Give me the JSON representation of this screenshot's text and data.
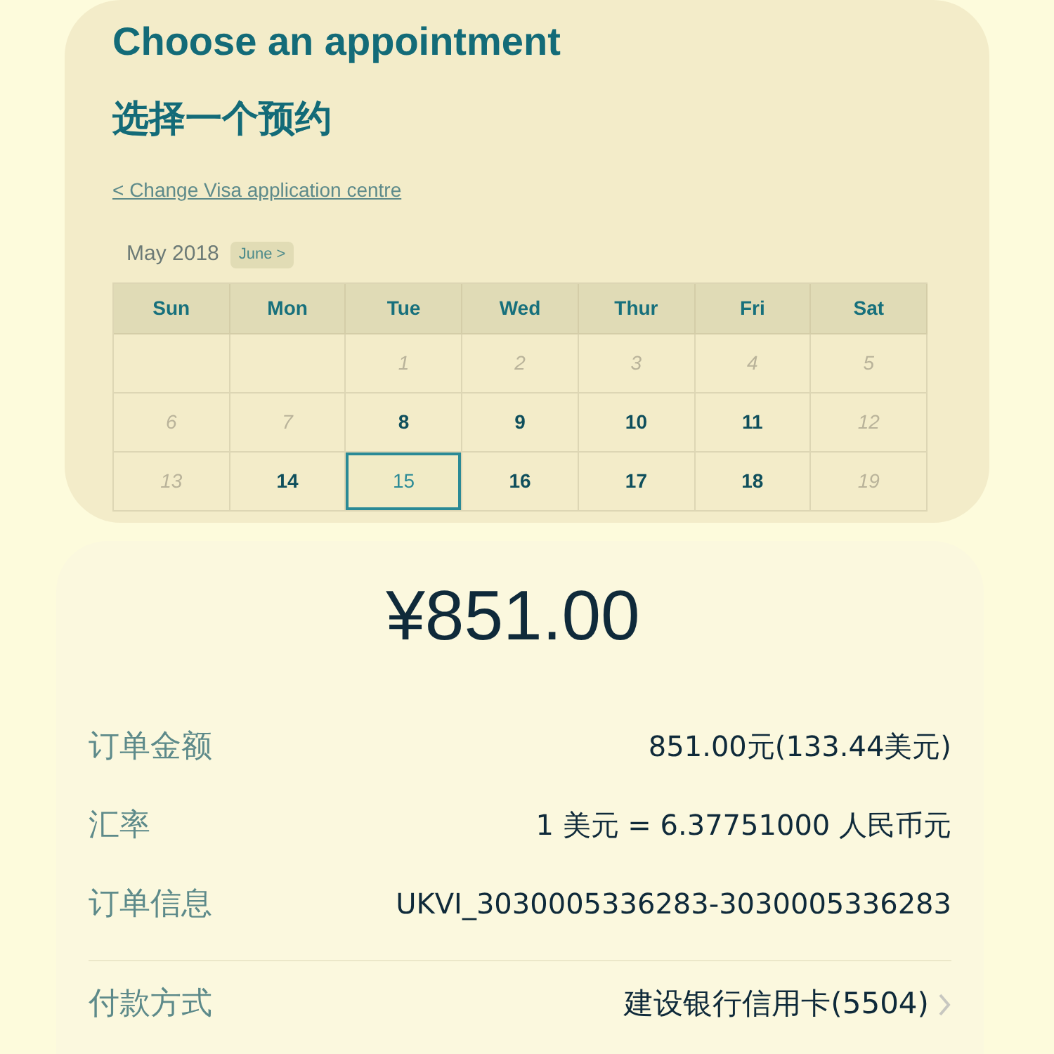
{
  "appointment": {
    "title": "Choose an appointment",
    "title_zh": "选择一个预约",
    "back_link": "< Change Visa application centre",
    "month": "May 2018",
    "next_month_button": "June >",
    "weekdays": [
      "Sun",
      "Mon",
      "Tue",
      "Wed",
      "Thur",
      "Fri",
      "Sat"
    ],
    "weeks": [
      [
        {
          "kind": "blank"
        },
        {
          "kind": "blank"
        },
        {
          "day": "1",
          "kind": "unavailable",
          "selected": false
        },
        {
          "day": "2",
          "kind": "unavailable",
          "selected": false
        },
        {
          "day": "3",
          "kind": "unavailable",
          "selected": false
        },
        {
          "day": "4",
          "kind": "unavailable",
          "selected": false
        },
        {
          "day": "5",
          "kind": "unavailable",
          "selected": false
        }
      ],
      [
        {
          "day": "6",
          "kind": "unavailable",
          "selected": false
        },
        {
          "day": "7",
          "kind": "unavailable",
          "selected": false
        },
        {
          "day": "8",
          "kind": "available",
          "selected": false
        },
        {
          "day": "9",
          "kind": "available",
          "selected": false
        },
        {
          "day": "10",
          "kind": "available",
          "selected": false
        },
        {
          "day": "11",
          "kind": "available",
          "selected": false
        },
        {
          "day": "12",
          "kind": "unavailable",
          "selected": false
        }
      ],
      [
        {
          "day": "13",
          "kind": "unavailable",
          "selected": false
        },
        {
          "day": "14",
          "kind": "available",
          "selected": false
        },
        {
          "day": "15",
          "kind": "available",
          "selected": true
        },
        {
          "day": "16",
          "kind": "available",
          "selected": false
        },
        {
          "day": "17",
          "kind": "available",
          "selected": false
        },
        {
          "day": "18",
          "kind": "available",
          "selected": false
        },
        {
          "day": "19",
          "kind": "unavailable",
          "selected": false
        }
      ]
    ]
  },
  "payment": {
    "amount": "¥851.00",
    "rows": [
      {
        "label": "订单金额",
        "value": "851.00元(133.44美元)",
        "kind": "info"
      },
      {
        "label": "汇率",
        "value": "1 美元 = 6.37751000 人民币元",
        "kind": "info"
      },
      {
        "label": "订单信息",
        "value": "UKVI_3030005336283-3030005336283",
        "kind": "info"
      },
      {
        "label": "付款方式",
        "value": "建设银行信用卡(5504)",
        "kind": "link"
      }
    ]
  }
}
